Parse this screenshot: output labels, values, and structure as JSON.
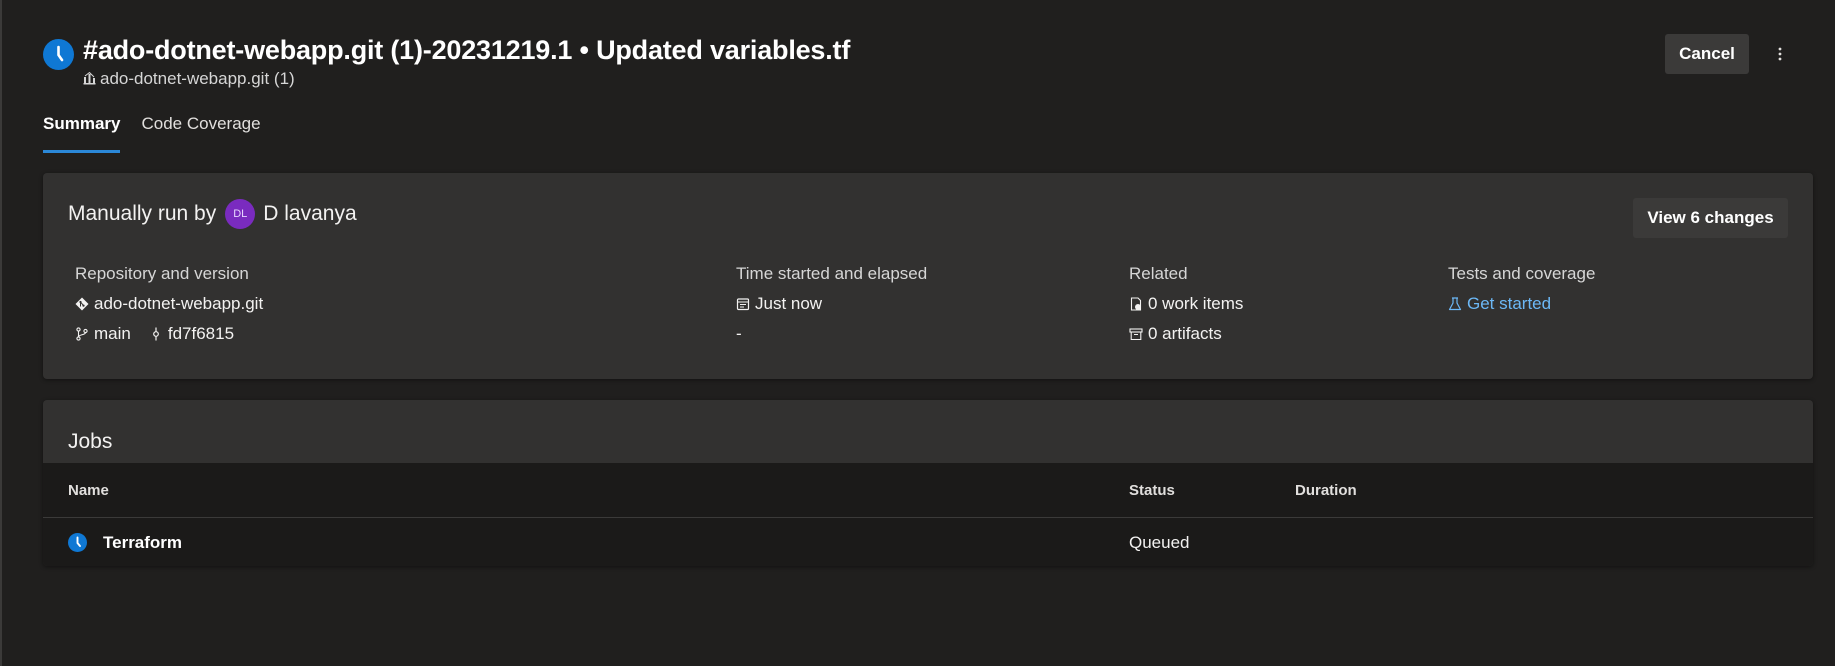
{
  "header": {
    "title": "#ado-dotnet-webapp.git (1)-20231219.1 • Updated variables.tf",
    "pipeline_name": "ado-dotnet-webapp.git (1)",
    "cancel_label": "Cancel",
    "status_icon": "clock-icon",
    "accent_color": "#0f78d4"
  },
  "tabs": [
    {
      "label": "Summary",
      "active": true
    },
    {
      "label": "Code Coverage",
      "active": false
    }
  ],
  "summary": {
    "run_by_prefix": "Manually run by",
    "user_initials": "DL",
    "user_name": "D lavanya",
    "view_changes_label": "View 6 changes",
    "repository": {
      "heading": "Repository and version",
      "repo_name": "ado-dotnet-webapp.git",
      "branch": "main",
      "commit": "fd7f6815"
    },
    "time": {
      "heading": "Time started and elapsed",
      "started": "Just now",
      "elapsed": "-"
    },
    "related": {
      "heading": "Related",
      "work_items": "0 work items",
      "artifacts": "0 artifacts"
    },
    "tests": {
      "heading": "Tests and coverage",
      "link_label": "Get started"
    }
  },
  "jobs": {
    "title": "Jobs",
    "columns": [
      "Name",
      "Status",
      "Duration"
    ],
    "rows": [
      {
        "name": "Terraform",
        "status": "Queued",
        "duration": ""
      }
    ]
  }
}
